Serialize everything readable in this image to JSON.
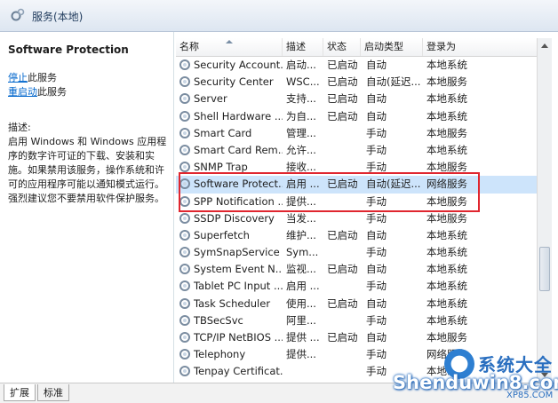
{
  "window": {
    "title": "服务(本地)"
  },
  "left_panel": {
    "service_name": "Software Protection",
    "actions": [
      {
        "link": "停止",
        "rest": "此服务"
      },
      {
        "link": "重启动",
        "rest": "此服务"
      }
    ],
    "description_label": "描述:",
    "description": "启用 Windows 和 Windows 应用程序的数字许可证的下载、安装和实施。如果禁用该服务，操作系统和许可的应用程序可能以通知模式运行。强烈建议您不要禁用软件保护服务。"
  },
  "table": {
    "columns": [
      "名称",
      "描述",
      "状态",
      "启动类型",
      "登录为"
    ],
    "rows": [
      {
        "name": "Security Account...",
        "desc": "启动...",
        "status": "已启动",
        "startup": "自动",
        "logon": "本地系统"
      },
      {
        "name": "Security Center",
        "desc": "WSC...",
        "status": "已启动",
        "startup": "自动(延迟...",
        "logon": "本地服务"
      },
      {
        "name": "Server",
        "desc": "支持...",
        "status": "已启动",
        "startup": "自动",
        "logon": "本地系统"
      },
      {
        "name": "Shell Hardware ...",
        "desc": "为自...",
        "status": "已启动",
        "startup": "自动",
        "logon": "本地系统"
      },
      {
        "name": "Smart Card",
        "desc": "管理...",
        "status": "",
        "startup": "手动",
        "logon": "本地服务"
      },
      {
        "name": "Smart Card Rem...",
        "desc": "允许...",
        "status": "",
        "startup": "手动",
        "logon": "本地系统"
      },
      {
        "name": "SNMP Trap",
        "desc": "接收...",
        "status": "",
        "startup": "手动",
        "logon": "本地服务"
      },
      {
        "name": "Software Protect...",
        "desc": "启用 ...",
        "status": "已启动",
        "startup": "自动(延迟...",
        "logon": "网络服务",
        "selected": true
      },
      {
        "name": "SPP Notification ...",
        "desc": "提供...",
        "status": "",
        "startup": "手动",
        "logon": "本地服务"
      },
      {
        "name": "SSDP Discovery",
        "desc": "当发...",
        "status": "",
        "startup": "手动",
        "logon": "本地服务"
      },
      {
        "name": "Superfetch",
        "desc": "维护...",
        "status": "已启动",
        "startup": "自动",
        "logon": "本地系统"
      },
      {
        "name": "SymSnapService",
        "desc": "Sym...",
        "status": "",
        "startup": "手动",
        "logon": "本地系统"
      },
      {
        "name": "System Event N...",
        "desc": "监视...",
        "status": "已启动",
        "startup": "自动",
        "logon": "本地系统"
      },
      {
        "name": "Tablet PC Input ...",
        "desc": "启用 ...",
        "status": "",
        "startup": "手动",
        "logon": "本地系统"
      },
      {
        "name": "Task Scheduler",
        "desc": "使用...",
        "status": "已启动",
        "startup": "自动",
        "logon": "本地系统"
      },
      {
        "name": "TBSecSvc",
        "desc": "阿里...",
        "status": "",
        "startup": "手动",
        "logon": "本地系统"
      },
      {
        "name": "TCP/IP NetBIOS ...",
        "desc": "提供 ...",
        "status": "已启动",
        "startup": "自动",
        "logon": "本地服务"
      },
      {
        "name": "Telephony",
        "desc": "提供...",
        "status": "",
        "startup": "手动",
        "logon": "网络服务"
      },
      {
        "name": "Tenpay Certificat...",
        "desc": "",
        "status": "",
        "startup": "手动",
        "logon": "本地系统"
      }
    ]
  },
  "tabs": [
    "扩展",
    "标准"
  ],
  "watermark": {
    "brand": "系统大全",
    "url": "Shenduwin8.com",
    "sub": "XP85.COM"
  },
  "colors": {
    "selection": "#cde4fb",
    "highlight_box": "#e0262f",
    "link": "#0066cc"
  },
  "icons": {
    "service": "gear-icon",
    "title": "services-icon",
    "sort": "sort-ascending-icon"
  }
}
